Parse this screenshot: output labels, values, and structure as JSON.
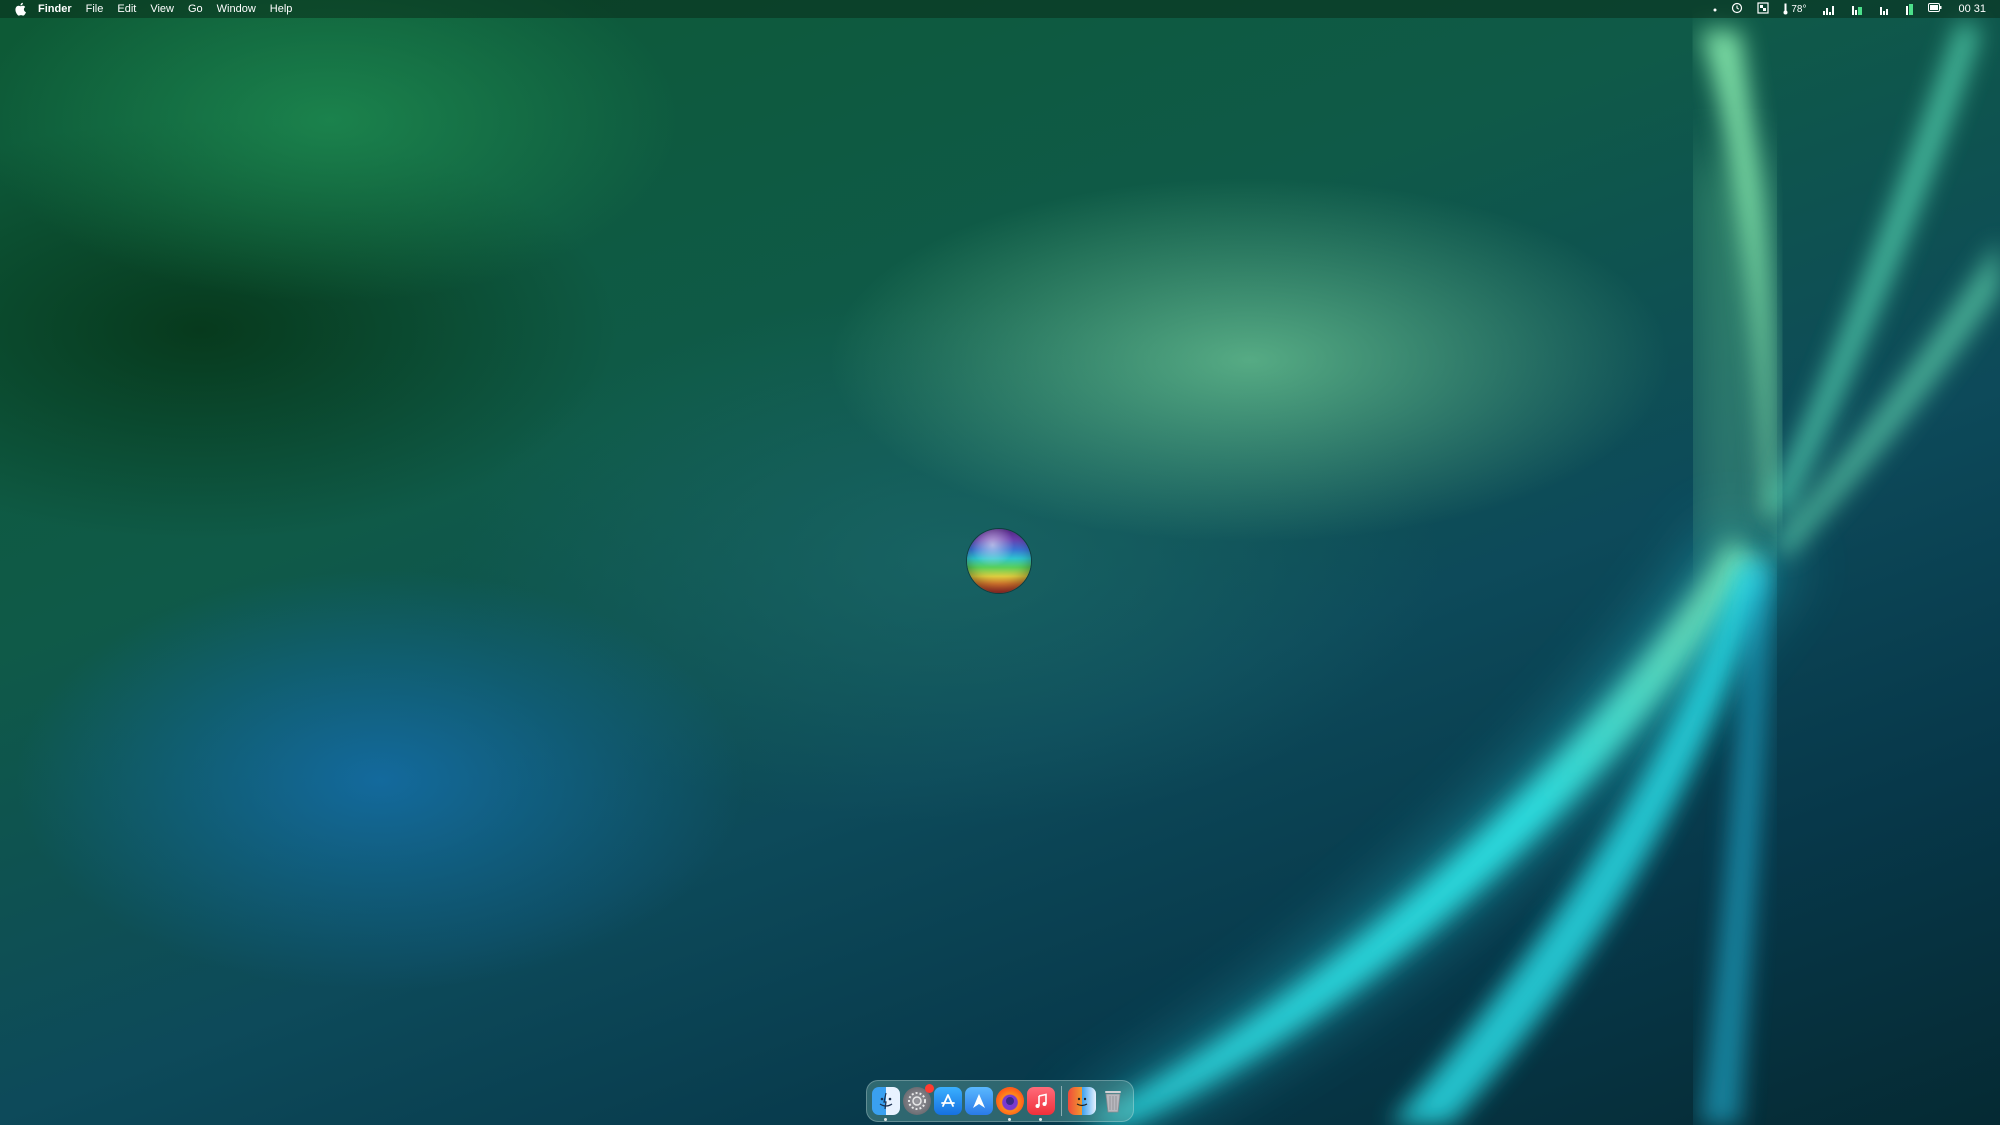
{
  "menubar": {
    "app_name": "Finder",
    "items": [
      "File",
      "Edit",
      "View",
      "Go",
      "Window",
      "Help"
    ],
    "status": {
      "temperature": "78°",
      "clock": "00 31"
    }
  },
  "dock": {
    "apps": [
      {
        "name": "Finder",
        "icon": "finder-icon",
        "running": true
      },
      {
        "name": "System Preferences",
        "icon": "gear-icon",
        "badge": true
      },
      {
        "name": "App Store",
        "icon": "app-store-icon"
      },
      {
        "name": "Instruments",
        "icon": "instruments-icon"
      },
      {
        "name": "Firefox",
        "icon": "firefox-icon",
        "running": true
      },
      {
        "name": "Music",
        "icon": "music-icon",
        "running": true
      },
      {
        "name": "Migration Assistant",
        "icon": "migration-icon"
      },
      {
        "name": "Trash",
        "icon": "trash-icon"
      }
    ]
  },
  "colors": {
    "wallpaper_base": "#0d4a5a",
    "beam_cyan": "#2ff0f0",
    "beam_green": "#7ff0a0",
    "badge": "#ff3b30"
  }
}
